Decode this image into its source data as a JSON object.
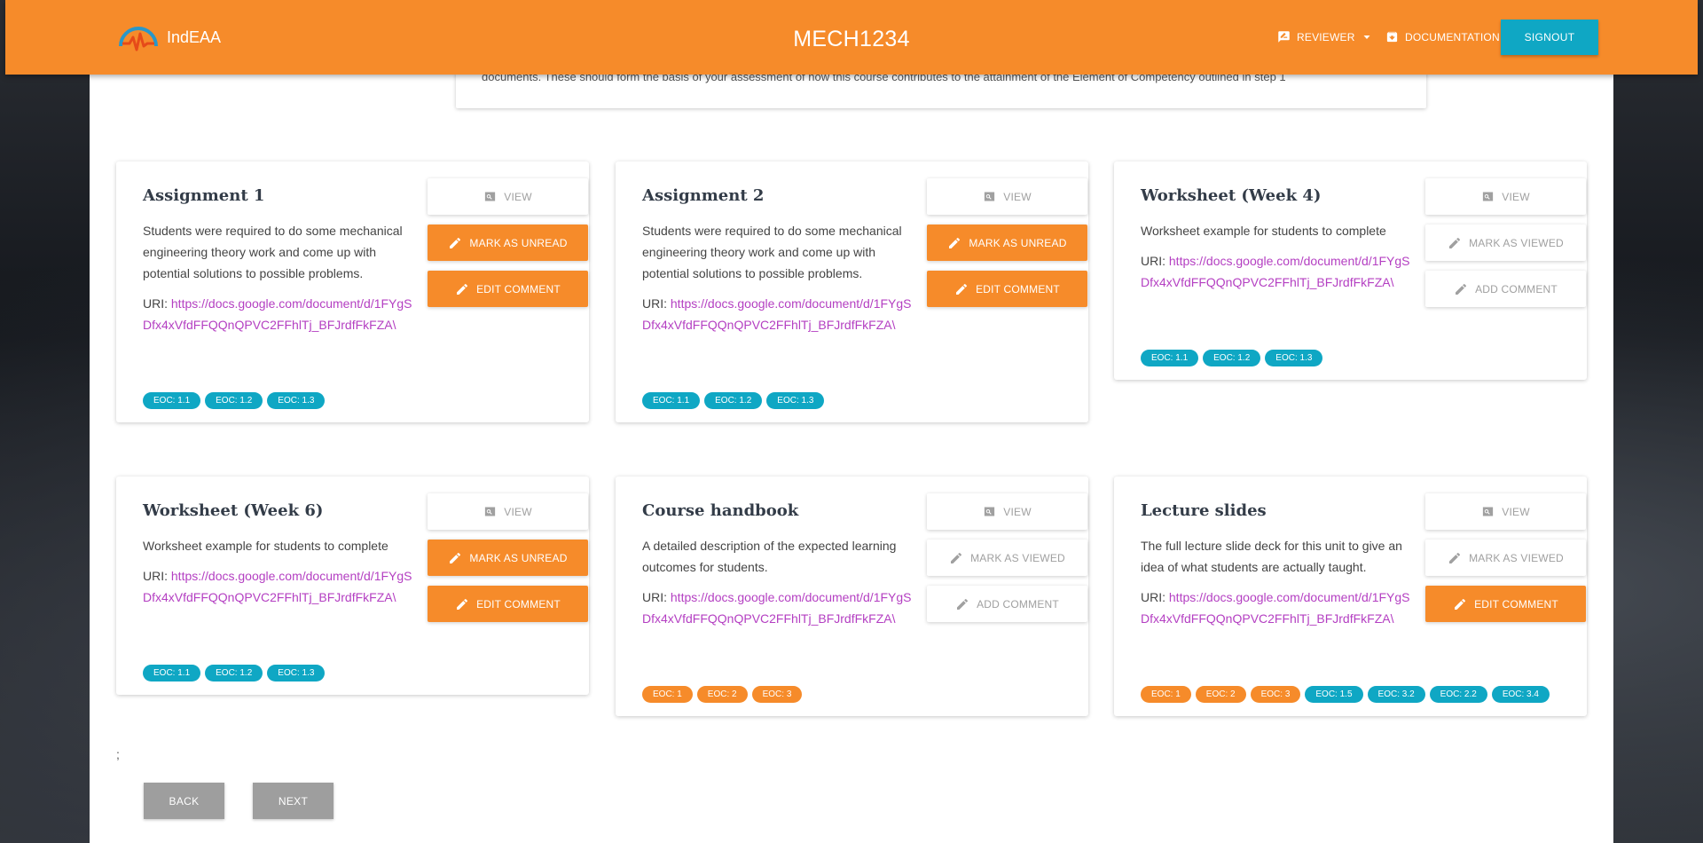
{
  "header": {
    "brand": "IndEAA",
    "course_code": "MECH1234",
    "reviewer_label": "REVIEWER",
    "documentation_label": "DOCUMENTATION",
    "signout_label": "SIGNOUT"
  },
  "info_card": {
    "text": "documents. These should form the basis of your assessment of how this course contributes to the attainment of the Element of Competency outlined in step 1"
  },
  "cards": [
    {
      "title": "Assignment 1",
      "description": "Students were required to do some mechanical engineering theory work and come up with potential solutions to possible problems.",
      "uri_label": "URI:",
      "uri": "https://docs.google.com/document/d/1FYgSDfx4xVfdFFQQnQPVC2FFhlTj_BFJrdfFkFZA\\",
      "buttons": [
        "VIEW",
        "MARK AS UNREAD",
        "EDIT COMMENT"
      ],
      "tags": [
        "EOC: 1.1",
        "EOC: 1.2",
        "EOC: 1.3"
      ]
    },
    {
      "title": "Assignment 2",
      "description": "Students were required to do some mechanical engineering theory work and come up with potential solutions to possible problems.",
      "uri_label": "URI:",
      "uri": "https://docs.google.com/document/d/1FYgSDfx4xVfdFFQQnQPVC2FFhlTj_BFJrdfFkFZA\\",
      "buttons": [
        "VIEW",
        "MARK AS UNREAD",
        "EDIT COMMENT"
      ],
      "tags": [
        "EOC: 1.1",
        "EOC: 1.2",
        "EOC: 1.3"
      ]
    },
    {
      "title": "Worksheet (Week 4)",
      "description": "Worksheet example for students to complete",
      "uri_label": "URI:",
      "uri": "https://docs.google.com/document/d/1FYgSDfx4xVfdFFQQnQPVC2FFhlTj_BFJrdfFkFZA\\",
      "buttons": [
        "VIEW",
        "MARK AS VIEWED",
        "ADD COMMENT"
      ],
      "tags": [
        "EOC: 1.1",
        "EOC: 1.2",
        "EOC: 1.3"
      ]
    },
    {
      "title": "Worksheet (Week 6)",
      "description": "Worksheet example for students to complete",
      "uri_label": "URI:",
      "uri": "https://docs.google.com/document/d/1FYgSDfx4xVfdFFQQnQPVC2FFhlTj_BFJrdfFkFZA\\",
      "buttons": [
        "VIEW",
        "MARK AS UNREAD",
        "EDIT COMMENT"
      ],
      "tags": [
        "EOC: 1.1",
        "EOC: 1.2",
        "EOC: 1.3"
      ]
    },
    {
      "title": "Course handbook",
      "description": "A detailed description of the expected learning outcomes for students.",
      "uri_label": "URI:",
      "uri": "https://docs.google.com/document/d/1FYgSDfx4xVfdFFQQnQPVC2FFhlTj_BFJrdfFkFZA\\",
      "buttons": [
        "VIEW",
        "MARK AS VIEWED",
        "ADD COMMENT"
      ],
      "tags": [
        "EOC: 1",
        "EOC: 2",
        "EOC: 3"
      ]
    },
    {
      "title": "Lecture slides",
      "description": "The full lecture slide deck for this unit to give an idea of what students are actually taught.",
      "uri_label": "URI:",
      "uri": "https://docs.google.com/document/d/1FYgSDfx4xVfdFFQQnQPVC2FFhlTj_BFJrdfFkFZA\\",
      "buttons": [
        "VIEW",
        "MARK AS VIEWED",
        "EDIT COMMENT"
      ],
      "tags": [
        "EOC: 1",
        "EOC: 2",
        "EOC: 3",
        "EOC: 1.5",
        "EOC: 3.2",
        "EOC: 2.2",
        "EOC: 3.4"
      ]
    }
  ],
  "footer": {
    "stray_text": ";",
    "back_label": "BACK",
    "next_label": "NEXT"
  },
  "colors": {
    "primary_orange": "#f68b2a",
    "accent_teal": "#0fa7c4",
    "link_purple": "#b43fc2",
    "disabled_grey": "#9e9e9e"
  },
  "icons": {
    "view": "search-icon",
    "mark": "pencil-icon",
    "comment": "pencil-icon",
    "reviewer": "feedback-icon",
    "documentation": "archive-icon"
  }
}
